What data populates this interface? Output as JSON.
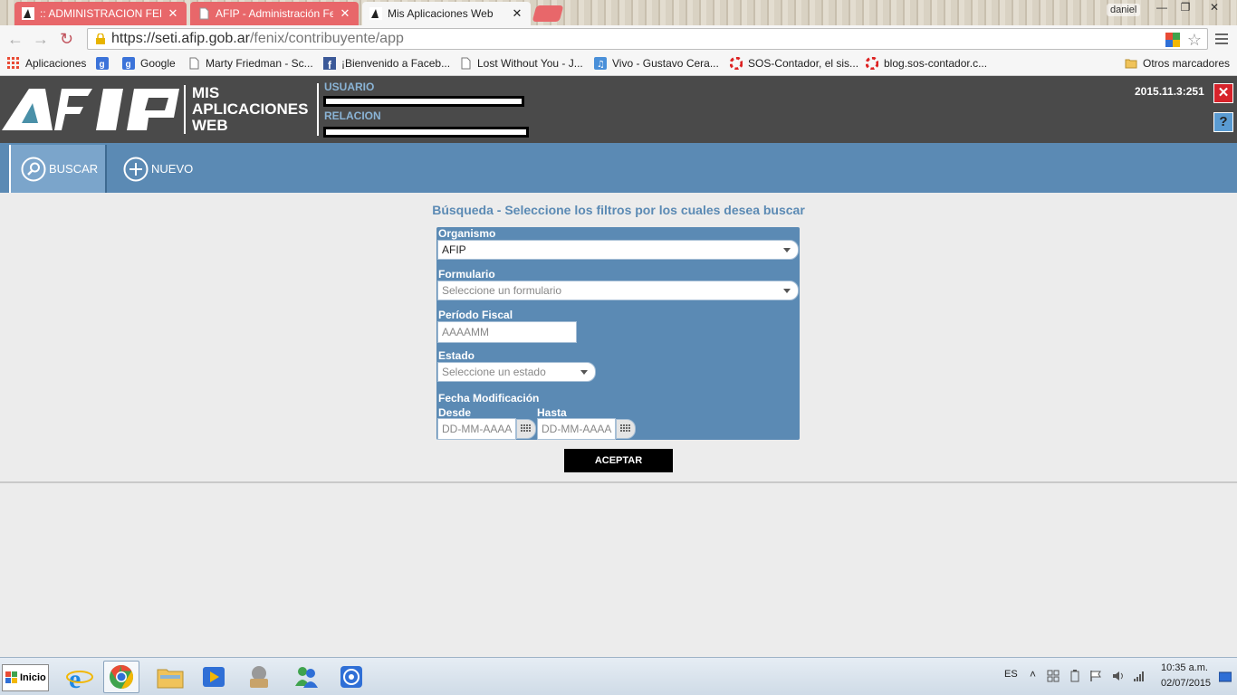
{
  "browser": {
    "tabs": [
      {
        "label": ":: ADMINISTRACION FEDE",
        "state": "inactive"
      },
      {
        "label": "AFIP - Administración Fed",
        "state": "inactive"
      },
      {
        "label": "Mis Aplicaciones Web",
        "state": "active"
      }
    ],
    "window_user": "daniel",
    "url_host": "https://seti.afip.gob.ar",
    "url_path": "/fenix/contribuyente/app",
    "bookmarks": [
      {
        "label": "Aplicaciones",
        "icon": "apps-grid-icon"
      },
      {
        "label": "",
        "icon": "google-icon"
      },
      {
        "label": "Google",
        "icon": "google-icon"
      },
      {
        "label": "Marty Friedman - Sc...",
        "icon": "page-icon"
      },
      {
        "label": "¡Bienvenido a Faceb...",
        "icon": "facebook-icon"
      },
      {
        "label": "Lost Without You - J...",
        "icon": "page-icon"
      },
      {
        "label": "Vivo - Gustavo Cera...",
        "icon": "music-icon"
      },
      {
        "label": "SOS-Contador, el sis...",
        "icon": "lifebuoy-icon"
      },
      {
        "label": "blog.sos-contador.c...",
        "icon": "lifebuoy-icon"
      }
    ],
    "other_bookmarks": "Otros marcadores"
  },
  "app": {
    "title_lines": [
      "MIS",
      "APLICACIONES",
      "WEB"
    ],
    "user_label": "USUARIO",
    "relation_label": "RELACION",
    "version": "2015.11.3:251",
    "close_label": "✕",
    "help_label": "?",
    "menu": {
      "search": "BUSCAR",
      "new": "NUEVO"
    }
  },
  "search": {
    "title": "Búsqueda - Seleccione los filtros por los cuales desea buscar",
    "organismo_label": "Organismo",
    "organismo_value": "AFIP",
    "formulario_label": "Formulario",
    "formulario_placeholder": "Seleccione un formulario",
    "periodo_label": "Período Fiscal",
    "periodo_placeholder": "AAAAMM",
    "estado_label": "Estado",
    "estado_placeholder": "Seleccione un estado",
    "fecha_label": "Fecha Modificación",
    "desde_label": "Desde",
    "hasta_label": "Hasta",
    "date_placeholder": "DD-MM-AAAA",
    "submit": "ACEPTAR"
  },
  "taskbar": {
    "start": "Inicio",
    "language": "ES",
    "time": "10:35 a.m.",
    "date": "02/07/2015"
  },
  "colors": {
    "header_bg": "#4a4a4a",
    "menu_bg": "#5b8ab4",
    "label_blue": "#8ab4d6",
    "tab_red": "#e8676a"
  }
}
